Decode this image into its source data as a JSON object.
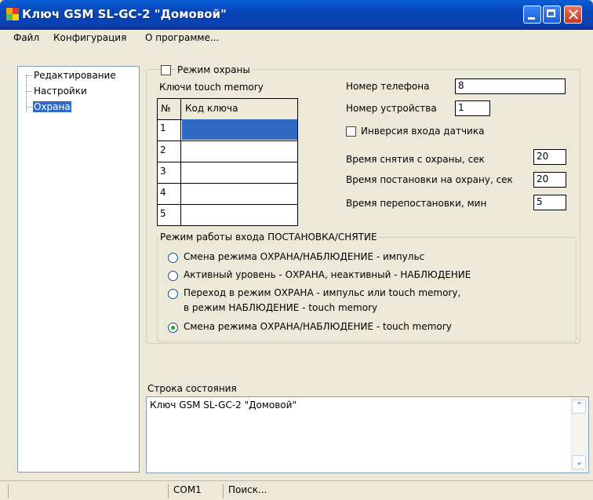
{
  "window": {
    "title": "Ключ GSM SL-GC-2 \"Домовой\""
  },
  "menu": {
    "file": "Файл",
    "config": "Конфигурация",
    "about": "О программе..."
  },
  "tree": {
    "items": [
      {
        "label": "Редактирование"
      },
      {
        "label": "Настройки"
      },
      {
        "label": "Охрана",
        "selected": true
      }
    ]
  },
  "guard": {
    "mode_checkbox_label": "Режим охраны",
    "mode_checked": false,
    "keys_caption": "Ключи touch memory",
    "keys_table": {
      "headers": [
        "№",
        "Код ключа"
      ],
      "rows": [
        {
          "num": "1",
          "code": "",
          "selected": true
        },
        {
          "num": "2",
          "code": ""
        },
        {
          "num": "3",
          "code": ""
        },
        {
          "num": "4",
          "code": ""
        },
        {
          "num": "5",
          "code": ""
        }
      ]
    },
    "phone_label": "Номер телефона",
    "phone_value": "8",
    "device_label": "Номер устройства",
    "device_value": "1",
    "invert_label": "Инверсия входа датчика",
    "invert_checked": false,
    "disarm_label": "Время снятия с охраны, сек",
    "disarm_value": "20",
    "arm_label": "Время постановки на охрану, сек",
    "arm_value": "20",
    "rearm_label": "Время перепостановки, мин",
    "rearm_value": "5"
  },
  "input_mode": {
    "caption": "Режим работы входа ПОСТАНОВКА/СНЯТИЕ",
    "options": [
      {
        "line1": "Смена режима ОХРАНА/НАБЛЮДЕНИЕ - импульс",
        "line2": "",
        "selected": false
      },
      {
        "line1": "Активный уровень - ОХРАНА, неактивный - НАБЛЮДЕНИЕ",
        "line2": "",
        "selected": false
      },
      {
        "line1": "Переход в режим ОХРАНА - импульс или touch memory,",
        "line2": "в режим НАБЛЮДЕНИЕ - touch memory",
        "selected": false
      },
      {
        "line1": "Смена режима ОХРАНА/НАБЛЮДЕНИЕ - touch memory",
        "line2": "",
        "selected": true
      }
    ]
  },
  "status_area": {
    "caption": "Строка состояния",
    "text": "Ключ GSM SL-GC-2 \"Домовой\""
  },
  "statusbar": {
    "port": "COM1",
    "state": "Поиск..."
  },
  "colors": {
    "titlebar": "#0845b7",
    "selection": "#316ac5",
    "background": "#ece9d8",
    "radio_dot": "#21a121"
  },
  "icons": [
    "app-icon",
    "minimize-icon",
    "maximize-icon",
    "close-icon",
    "scroll-up-icon",
    "scroll-down-icon"
  ]
}
